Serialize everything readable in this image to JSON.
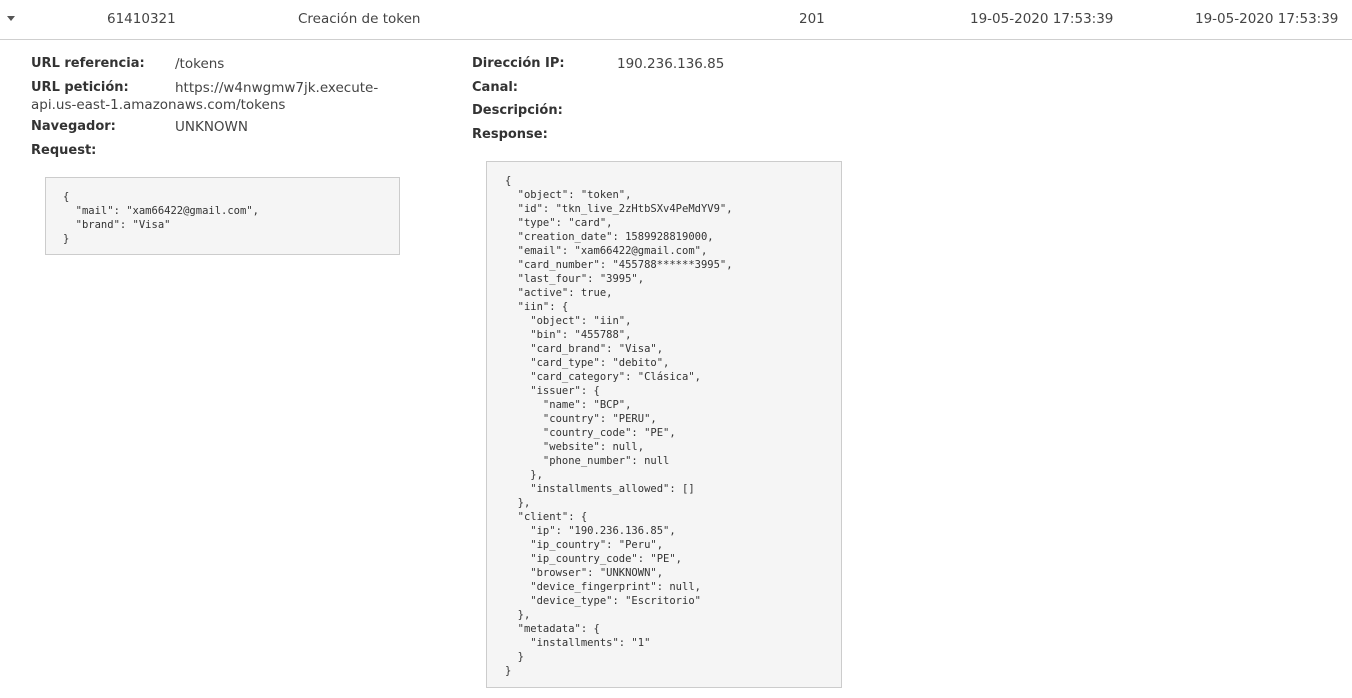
{
  "row": {
    "id": "61410321",
    "operation": "Creación de token",
    "status_code": "201",
    "created_at": "19-05-2020 17:53:39",
    "updated_at": "19-05-2020 17:53:39"
  },
  "detail": {
    "url_ref_label": "URL referencia:",
    "url_ref_value": "/tokens",
    "url_req_label": "URL petición:",
    "url_req_value_line1": "https://w4nwgmw7jk.execute-",
    "url_req_value_line2": "api.us-east-1.amazonaws.com/tokens",
    "browser_label": "Navegador:",
    "browser_value": "UNKNOWN",
    "request_label": "Request:",
    "ip_label": "Dirección IP:",
    "ip_value": "190.236.136.85",
    "channel_label": "Canal:",
    "description_label": "Descripción:",
    "response_label": "Response:",
    "request_body": "{\n  \"mail\": \"xam66422@gmail.com\",\n  \"brand\": \"Visa\"\n}",
    "response_body": "{\n  \"object\": \"token\",\n  \"id\": \"tkn_live_2zHtbSXv4PeMdYV9\",\n  \"type\": \"card\",\n  \"creation_date\": 1589928819000,\n  \"email\": \"xam66422@gmail.com\",\n  \"card_number\": \"455788******3995\",\n  \"last_four\": \"3995\",\n  \"active\": true,\n  \"iin\": {\n    \"object\": \"iin\",\n    \"bin\": \"455788\",\n    \"card_brand\": \"Visa\",\n    \"card_type\": \"debito\",\n    \"card_category\": \"Clásica\",\n    \"issuer\": {\n      \"name\": \"BCP\",\n      \"country\": \"PERU\",\n      \"country_code\": \"PE\",\n      \"website\": null,\n      \"phone_number\": null\n    },\n    \"installments_allowed\": []\n  },\n  \"client\": {\n    \"ip\": \"190.236.136.85\",\n    \"ip_country\": \"Peru\",\n    \"ip_country_code\": \"PE\",\n    \"browser\": \"UNKNOWN\",\n    \"device_fingerprint\": null,\n    \"device_type\": \"Escritorio\"\n  },\n  \"metadata\": {\n    \"installments\": \"1\"\n  }\n}"
  }
}
